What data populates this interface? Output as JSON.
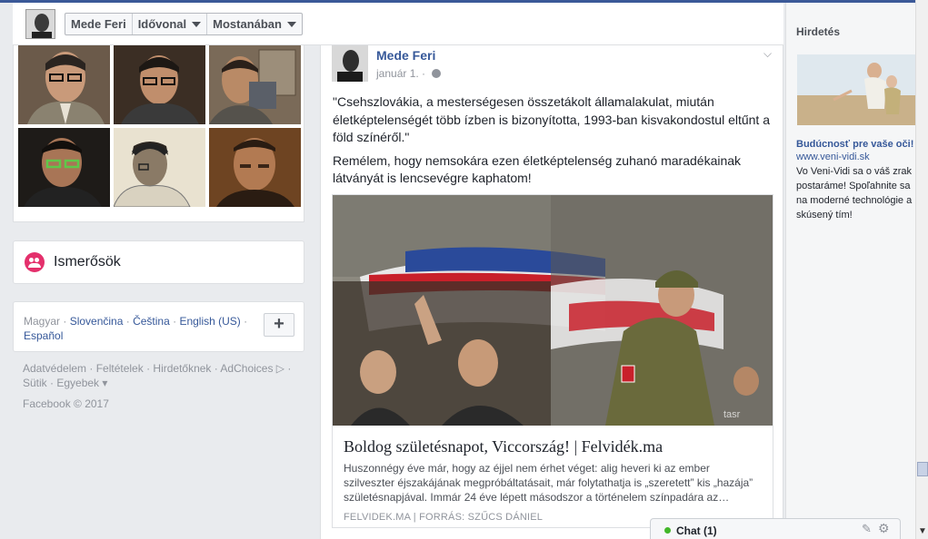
{
  "header": {
    "name": "Mede Feri",
    "timeline": "Idővonal",
    "recent": "Mostanában"
  },
  "left": {
    "friends_label": "Ismerősök",
    "languages": {
      "current": "Magyar",
      "others": [
        "Slovenčina",
        "Čeština",
        "English (US)",
        "Español"
      ],
      "plus": "+"
    },
    "footer_links": "Adatvédelem · Feltételek · Hirdetőknek · AdChoices ▷ · Sütik · Egyebek ▾",
    "copyright": "Facebook © 2017"
  },
  "post": {
    "author": "Mede Feri",
    "date": "január 1. ·",
    "paragraph1": "\"Csehszlovákia, a mesterségesen összetákolt államalakulat, miután életképtelenségét több ízben is bizonyította, 1993-ban kisvakondostul eltűnt a föld színéről.\"",
    "paragraph2": "Remélem, hogy nemsokára ezen életképtelenség zuhanó maradékainak látványát is lencsevégre kaphatom!",
    "link": {
      "title": "Boldog születésnapot, Viccország! | Felvidék.ma",
      "description": "Huszonnégy éve már, hogy az éjjel nem érhet véget: alig heveri ki az ember szilveszter éjszakájának megpróbáltatásait, már folytathatja is „szeretett” kis „hazája” születésnapjával. Immár 24 éve lépett másodszor a történelem színpadára az…",
      "source": "FELVIDEK.MA | FORRÁS: SZŰCS DÁNIEL",
      "image_watermark": "tasr"
    }
  },
  "ads": {
    "heading": "Hirdetés",
    "title": "Budúcnosť pre vaše oči!",
    "url": "www.veni-vidi.sk",
    "body": "Vo Veni-Vidi sa o váš zrak postaráme! Spoľahnite sa na moderné technológie a skúsený tím!"
  },
  "chat": {
    "label": "Chat (1)"
  },
  "colors": {
    "link_blue": "#365899",
    "brand_blue": "#3b5998",
    "friends_pink": "#e4306c",
    "online_green": "#42b72a"
  },
  "icons": [
    "friends-icon",
    "globe-icon",
    "chevron-down-icon",
    "edit-icon",
    "gear-icon",
    "plus-icon"
  ]
}
